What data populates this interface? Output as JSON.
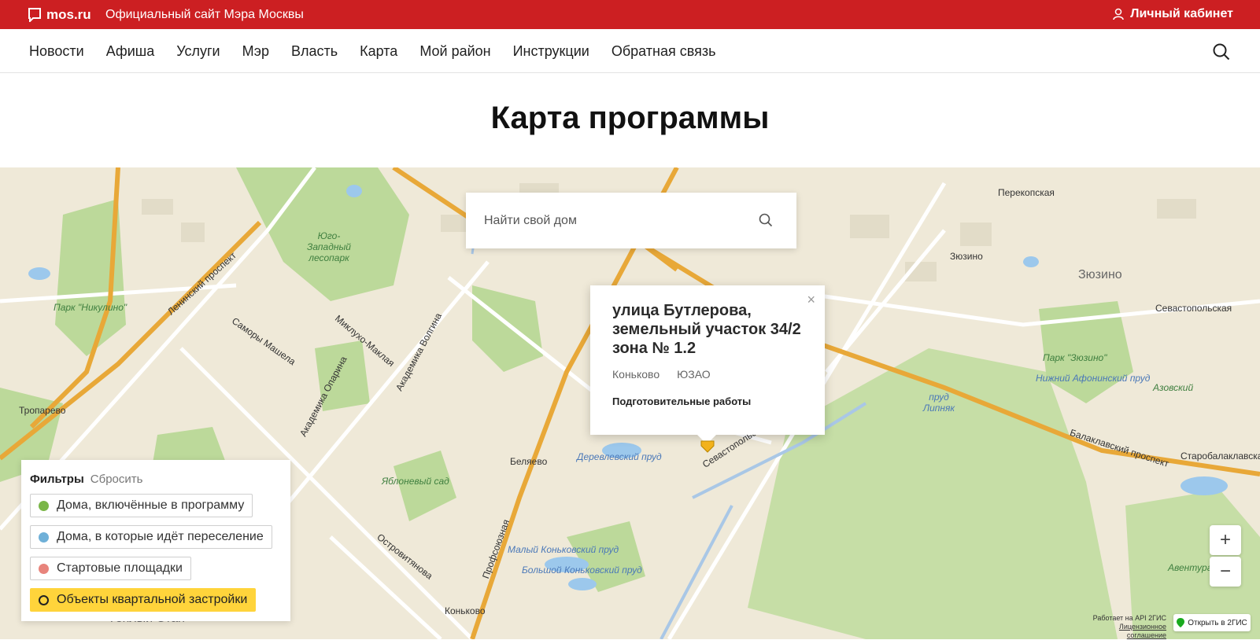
{
  "header": {
    "logo_text": "mos.ru",
    "site_title": "Официальный сайт Мэра Москвы",
    "cabinet_label": "Личный кабинет",
    "brand_color": "#cc1f22"
  },
  "nav": {
    "items": [
      "Новости",
      "Афиша",
      "Услуги",
      "Мэр",
      "Власть",
      "Карта",
      "Мой район",
      "Инструкции",
      "Обратная связь"
    ]
  },
  "page": {
    "title": "Карта программы"
  },
  "map": {
    "search_placeholder": "Найти свой дом",
    "popup": {
      "title": "улица Бутлерова, земельный участок 34/2 зона № 1.2",
      "district": "Коньково",
      "okrug": "ЮЗАО",
      "status": "Подготовительные работы"
    },
    "labels": {
      "troparevo": "Тропарево",
      "belyaevo": "Беляево",
      "konkovo": "Коньково",
      "zyuzino_station": "Зюзино",
      "zyuzino_area": "Зюзино",
      "sevastopolskaya": "Севастопольская",
      "azovskiy": "Азовский",
      "aventura": "Авентура",
      "perekopskaya": "Перекопская",
      "park_nikulino": "Парк \"Никулино\"",
      "park_zyuzino": "Парк \"Зюзино\"",
      "yugo_zapadny": "Юго-Западный лесопарк",
      "yablonevy_sad": "Яблоневый сад",
      "derevlevsky_prud": "Деревлевский пруд",
      "maly_konkovsky": "Малый Коньковский пруд",
      "bolshoy_konkovsky": "Большой Коньковский пруд",
      "nizhny_afoninsky": "Нижний Афонинский пруд",
      "prud_lipnyak": "пруд Липняк",
      "sevastopolsky_prospekt": "Севастопольский проспект",
      "balaklavsky_prospekt": "Балаклавский проспект",
      "leninsky_prospekt": "Ленинский проспект",
      "profsoyuznaya": "Профсоюзная",
      "teply_stan": "Тёплый Стан",
      "mikluho_maklaya": "Миклухо-Маклая",
      "akademika_volgina": "Академика Волгина",
      "akademika_oparina": "Академика Опарина",
      "ostrovityanova": "Островитянова",
      "samory_mashela": "Саморы Машела",
      "starobalaklavskaya": "Старобалаклавская"
    },
    "attribution_line1": "Работает на API 2ГИС",
    "attribution_line2": "Лицензионное соглашение",
    "open_2gis_label": "Открыть в 2ГИС",
    "zoom_in": "+",
    "zoom_out": "−"
  },
  "filters": {
    "title": "Фильтры",
    "reset_label": "Сбросить",
    "items": [
      {
        "label": "Дома, включённые в программу",
        "color": "#7ab648",
        "active": false
      },
      {
        "label": "Дома, в которые идёт переселение",
        "color": "#6fb0d8",
        "active": false
      },
      {
        "label": "Стартовые площадки",
        "color": "#e8847c",
        "active": false
      },
      {
        "label": "Объекты квартальной застройки",
        "color": "#ffd43b",
        "active": true
      }
    ]
  }
}
